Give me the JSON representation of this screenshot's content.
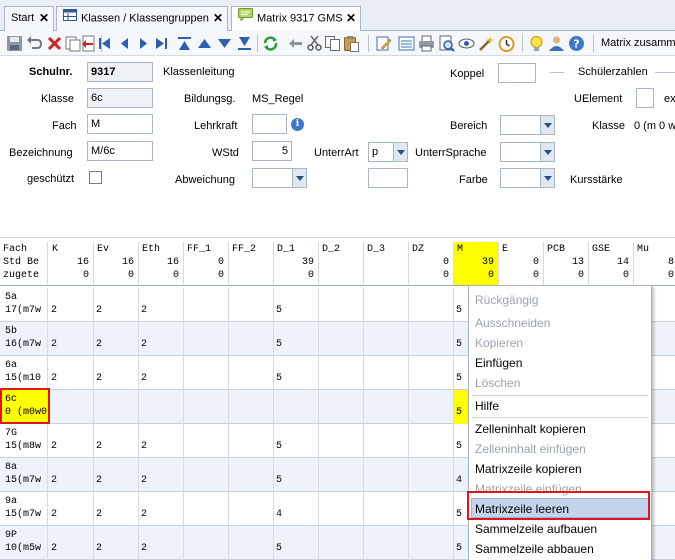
{
  "tabs": [
    {
      "label": "Start",
      "close": "✕"
    },
    {
      "label": "Klassen / Klassengruppen",
      "close": "✕"
    },
    {
      "label": "Matrix 9317 GMS",
      "close": "✕"
    }
  ],
  "toolbar": {
    "text": "Matrix zusamm"
  },
  "form": {
    "schulnr_label": "Schulnr.",
    "schulnr_value": "9317",
    "klassenleitung_label": "Klassenleitung",
    "koppel_label": "Koppel",
    "schuelerzahlen_label": "Schülerzahlen",
    "klasse_label": "Klasse",
    "klasse_value": "6c",
    "bildungsg_label": "Bildungsg.",
    "bildungsg_value": "MS_Regel",
    "uelement_label": "UElement",
    "ex_label": "ex",
    "fach_label": "Fach",
    "fach_value": "M",
    "lehrkraft_label": "Lehrkraft",
    "bereich_label": "Bereich",
    "klasse2_label": "Klasse",
    "klasse2_value": "0 (m 0 w",
    "bezeichnung_label": "Bezeichnung",
    "bezeichnung_value": "M/6c",
    "wstd_label": "WStd",
    "wstd_value": "5",
    "unterrart_label": "UnterrArt",
    "unterrart_value": "p",
    "unterrsprache_label": "UnterrSprache",
    "geschuetzt_label": "geschützt",
    "abweichung_label": "Abweichung",
    "farbe_label": "Farbe",
    "kursstaerke_label": "Kursstärke"
  },
  "grid": {
    "header_labels": [
      "Fach",
      "Std Be",
      "zugete"
    ],
    "columns": [
      {
        "name": "K",
        "std": "16",
        "zug": "0"
      },
      {
        "name": "Ev",
        "std": "16",
        "zug": "0"
      },
      {
        "name": "Eth",
        "std": "16",
        "zug": "0"
      },
      {
        "name": "FF_1",
        "std": "0",
        "zug": "0"
      },
      {
        "name": "FF_2",
        "std": "",
        "zug": ""
      },
      {
        "name": "D_1",
        "std": "39",
        "zug": "0"
      },
      {
        "name": "D_2",
        "std": "",
        "zug": ""
      },
      {
        "name": "D_3",
        "std": "",
        "zug": ""
      },
      {
        "name": "DZ",
        "std": "0",
        "zug": "0"
      },
      {
        "name": "M",
        "std": "39",
        "zug": "0"
      },
      {
        "name": "E",
        "std": "0",
        "zug": "0"
      },
      {
        "name": "PCB",
        "std": "13",
        "zug": "0"
      },
      {
        "name": "GSE",
        "std": "14",
        "zug": "0"
      },
      {
        "name": "Mu",
        "std": "8",
        "zug": "0"
      }
    ],
    "rows": [
      {
        "name": "5a",
        "sub": "17(m7w",
        "vals": [
          "2",
          "2",
          "2",
          "",
          "",
          "5",
          "",
          "",
          "",
          "5"
        ]
      },
      {
        "name": "5b",
        "sub": "16(m7w",
        "vals": [
          "2",
          "2",
          "2",
          "",
          "",
          "5",
          "",
          "",
          "",
          "5"
        ]
      },
      {
        "name": "6a",
        "sub": "15(m10",
        "vals": [
          "2",
          "2",
          "2",
          "",
          "",
          "5",
          "",
          "",
          "",
          "5"
        ]
      },
      {
        "name": "6c",
        "sub": "0 (m0w0",
        "vals": [
          "",
          "",
          "",
          "",
          "",
          "",
          "",
          "",
          "",
          "5"
        ]
      },
      {
        "name": "7G",
        "sub": "15(m8w",
        "vals": [
          "2",
          "2",
          "2",
          "",
          "",
          "5",
          "",
          "",
          "",
          "5"
        ]
      },
      {
        "name": "8a",
        "sub": "15(m7w",
        "vals": [
          "2",
          "2",
          "2",
          "",
          "",
          "5",
          "",
          "",
          "",
          "4"
        ]
      },
      {
        "name": "9a",
        "sub": "15(m7w",
        "vals": [
          "2",
          "2",
          "2",
          "",
          "",
          "4",
          "",
          "",
          "",
          "5"
        ]
      },
      {
        "name": "9P",
        "sub": "10(m5w",
        "vals": [
          "2",
          "2",
          "2",
          "",
          "",
          "5",
          "",
          "",
          "",
          "5"
        ]
      }
    ]
  },
  "context_menu": {
    "items": [
      {
        "label": "Rückgängig",
        "enabled": false
      },
      {
        "label": "Ausschneiden",
        "enabled": false
      },
      {
        "label": "Kopieren",
        "enabled": false
      },
      {
        "label": "Einfügen",
        "enabled": true
      },
      {
        "label": "Löschen",
        "enabled": false
      },
      {
        "label": "Hilfe",
        "enabled": true
      },
      {
        "label": "Zelleninhalt kopieren",
        "enabled": true
      },
      {
        "label": "Zelleninhalt einfügen",
        "enabled": false
      },
      {
        "label": "Matrixzeile kopieren",
        "enabled": true
      },
      {
        "label": "Matrixzeile einfügen",
        "enabled": false
      },
      {
        "label": "Matrixzeile leeren",
        "enabled": true,
        "highlighted": true
      },
      {
        "label": "Sammelzeile aufbauen",
        "enabled": true
      },
      {
        "label": "Sammelzeile abbauen",
        "enabled": true
      }
    ]
  },
  "colors": {
    "highlight_yellow": "#ffff00",
    "annotation_red": "#e0141d",
    "menu_hover": "#c3d4ea"
  }
}
